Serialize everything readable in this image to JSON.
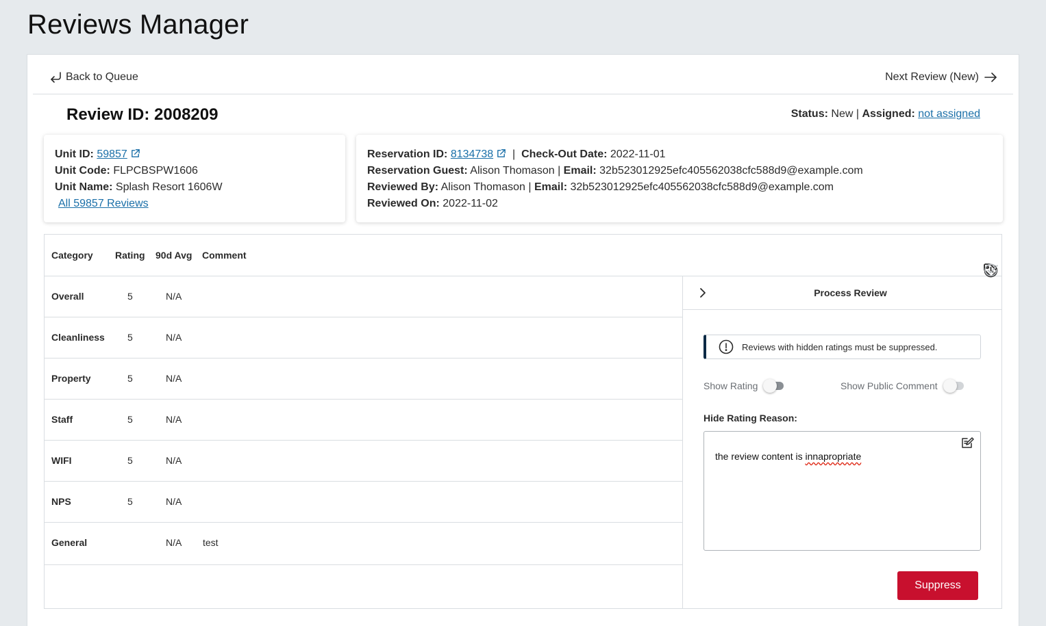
{
  "page_title": "Reviews Manager",
  "nav": {
    "back_label": "Back to Queue",
    "next_label": "Next Review (New)"
  },
  "review": {
    "id_label": "Review ID: 2008209",
    "status_label": "Status:",
    "status_value": "New",
    "separator": "|",
    "assigned_label": "Assigned:",
    "assigned_value": "not assigned"
  },
  "unit": {
    "id_label": "Unit ID:",
    "id_value": "59857",
    "code_label": "Unit Code:",
    "code_value": "FLPCBSPW1606",
    "name_label": "Unit Name:",
    "name_value": "Splash Resort 1606W",
    "all_reviews_link": "All 59857 Reviews"
  },
  "reservation": {
    "id_label": "Reservation ID:",
    "id_value": "8134738",
    "checkout_label": "Check-Out Date:",
    "checkout_value": "2022-11-01",
    "guest_label": "Reservation Guest:",
    "guest_value": "Alison Thomason",
    "guest_email_label": "Email:",
    "guest_email_value": "32b523012925efc405562038cfc588d9@example.com",
    "reviewed_by_label": "Reviewed By:",
    "reviewed_by_value": "Alison Thomason",
    "reviewer_email_label": "Email:",
    "reviewer_email_value": "32b523012925efc405562038cfc588d9@example.com",
    "reviewed_on_label": "Reviewed On:",
    "reviewed_on_value": "2022-11-02"
  },
  "table": {
    "headers": [
      "Category",
      "Rating",
      "90d Avg",
      "Comment"
    ],
    "rows": [
      {
        "category": "Overall",
        "rating": "5",
        "avg": "N/A",
        "comment": ""
      },
      {
        "category": "Cleanliness",
        "rating": "5",
        "avg": "N/A",
        "comment": ""
      },
      {
        "category": "Property",
        "rating": "5",
        "avg": "N/A",
        "comment": ""
      },
      {
        "category": "Staff",
        "rating": "5",
        "avg": "N/A",
        "comment": ""
      },
      {
        "category": "WIFI",
        "rating": "5",
        "avg": "N/A",
        "comment": ""
      },
      {
        "category": "NPS",
        "rating": "5",
        "avg": "N/A",
        "comment": ""
      },
      {
        "category": "General",
        "rating": "",
        "avg": "N/A",
        "comment": "test"
      }
    ]
  },
  "process": {
    "title": "Process Review",
    "alert_text": "Reviews with hidden ratings must be suppressed.",
    "show_rating_label": "Show Rating",
    "show_rating_on": false,
    "show_comment_label": "Show Public Comment",
    "show_comment_on": false,
    "reason_label": "Hide Rating Reason:",
    "reason_text_prefix": "the review content is ",
    "reason_text_misspelled": "innapropriate",
    "suppress_label": "Suppress"
  },
  "colors": {
    "background": "#e6eaed",
    "link": "#1a6fa8",
    "suppress_button": "#c8102e",
    "alert_accent": "#0b2a45"
  },
  "icons": {
    "back": "return-arrow-icon",
    "next": "arrow-right-icon",
    "external": "external-link-icon",
    "history": "history-icon",
    "tag": "tag-icon",
    "check": "check-circle-icon",
    "chevron": "chevron-right-icon",
    "alert": "exclamation-circle-icon",
    "edit": "edit-note-icon"
  }
}
